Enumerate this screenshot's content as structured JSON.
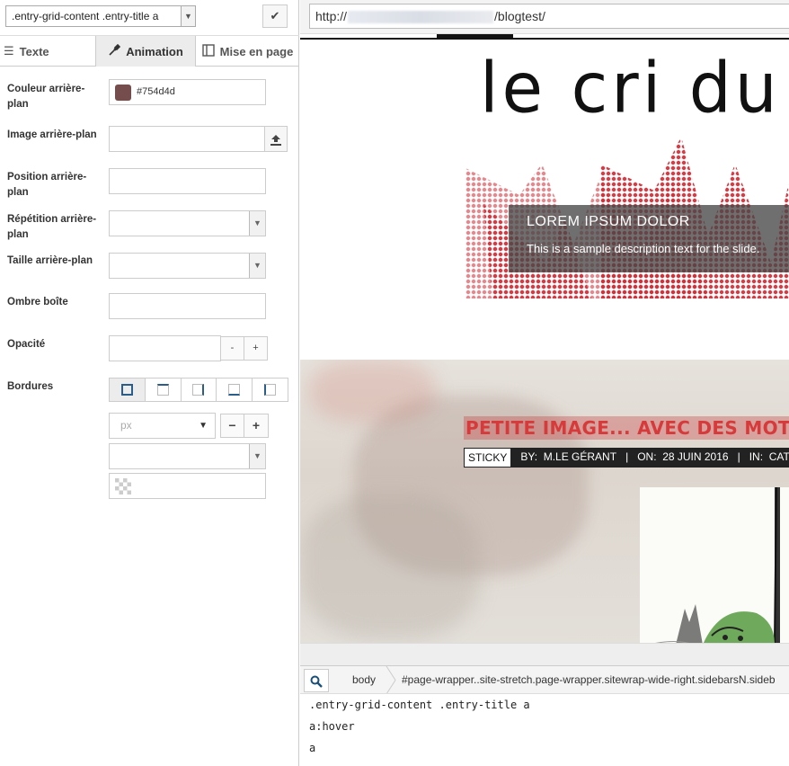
{
  "editor": {
    "selector_value": ".entry-grid-content .entry-title a",
    "tabs": [
      {
        "label": "Texte",
        "icon": "align-left-icon"
      },
      {
        "label": "Animation",
        "icon": "eyedropper-icon"
      },
      {
        "label": "Mise en page",
        "icon": "layout-icon"
      }
    ],
    "active_tab": "Animation",
    "fields": {
      "bg_color_label": "Couleur arrière-plan",
      "bg_color_value": "#754d4d",
      "bg_image_label": "Image arrière-plan",
      "bg_position_label": "Position arrière-plan",
      "bg_repeat_label": "Répétition arrière-plan",
      "bg_size_label": "Taille arrière-plan",
      "box_shadow_label": "Ombre boîte",
      "opacity_label": "Opacité",
      "borders_label": "Bordures",
      "unit_placeholder": "px",
      "minus": "-",
      "plus": "+"
    }
  },
  "preview": {
    "url_prefix": "http://",
    "url_suffix": "/blogtest/",
    "site_logo": "le cri du",
    "slider": {
      "title": "LOREM IPSUM DOLOR",
      "description": "This is a sample description text for the slide."
    },
    "post": {
      "title": "PETITE IMAGE... AVEC DES MOTS «",
      "sticky": "STICKY",
      "by_label": "BY:",
      "author": "M.LE GÉRANT",
      "on_label": "ON:",
      "date": "28 JUIN 2016",
      "in_label": "IN:",
      "category": "CAT A,"
    }
  },
  "breadcrumbs": {
    "items": [
      "body",
      "#page-wrapper..site-stretch.page-wrapper.sitewrap-wide-right.sidebarsN.sideb"
    ]
  },
  "rules": [
    ".entry-grid-content .entry-title a",
    "a:hover",
    "a"
  ],
  "colors": {
    "swatch": "#754d4d",
    "post_title": "#d63a3a",
    "halftone_red": "#e0202a"
  }
}
